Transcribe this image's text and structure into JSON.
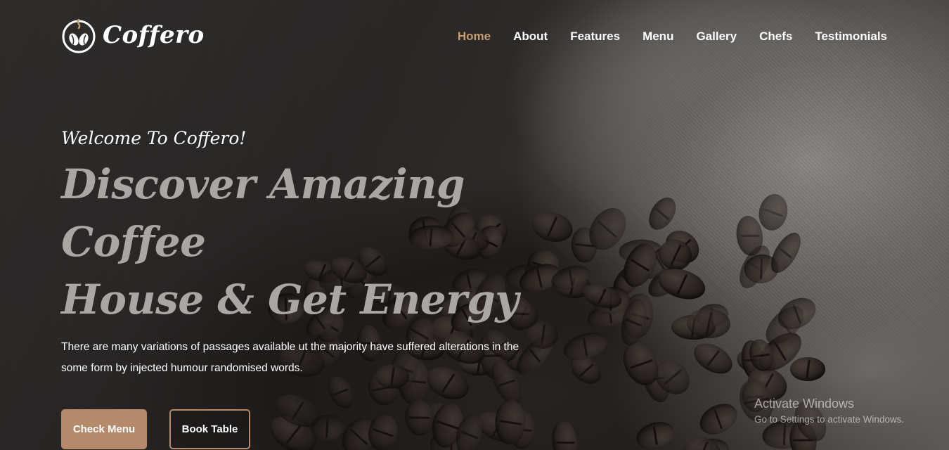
{
  "brand": {
    "name": "Coffero",
    "icon": "coffee-beans-logo-icon",
    "accent_color": "#c69c72"
  },
  "nav": {
    "items": [
      {
        "label": "Home",
        "active": true
      },
      {
        "label": "About",
        "active": false
      },
      {
        "label": "Features",
        "active": false
      },
      {
        "label": "Menu",
        "active": false
      },
      {
        "label": "Gallery",
        "active": false
      },
      {
        "label": "Chefs",
        "active": false
      },
      {
        "label": "Testimonials",
        "active": false
      }
    ]
  },
  "hero": {
    "welcome": "Welcome To Coffero!",
    "headline_line1": "Discover Amazing Coffee",
    "headline_line2": "House & Get Energy",
    "description": "There are many variations of passages available ut the majority have suffered alterations in the some form by injected humour randomised words.",
    "primary_button": "Check Menu",
    "secondary_button": "Book Table",
    "button_color": "#b48a6a"
  },
  "watermark": {
    "title": "Activate Windows",
    "subtitle": "Go to Settings to activate Windows."
  }
}
